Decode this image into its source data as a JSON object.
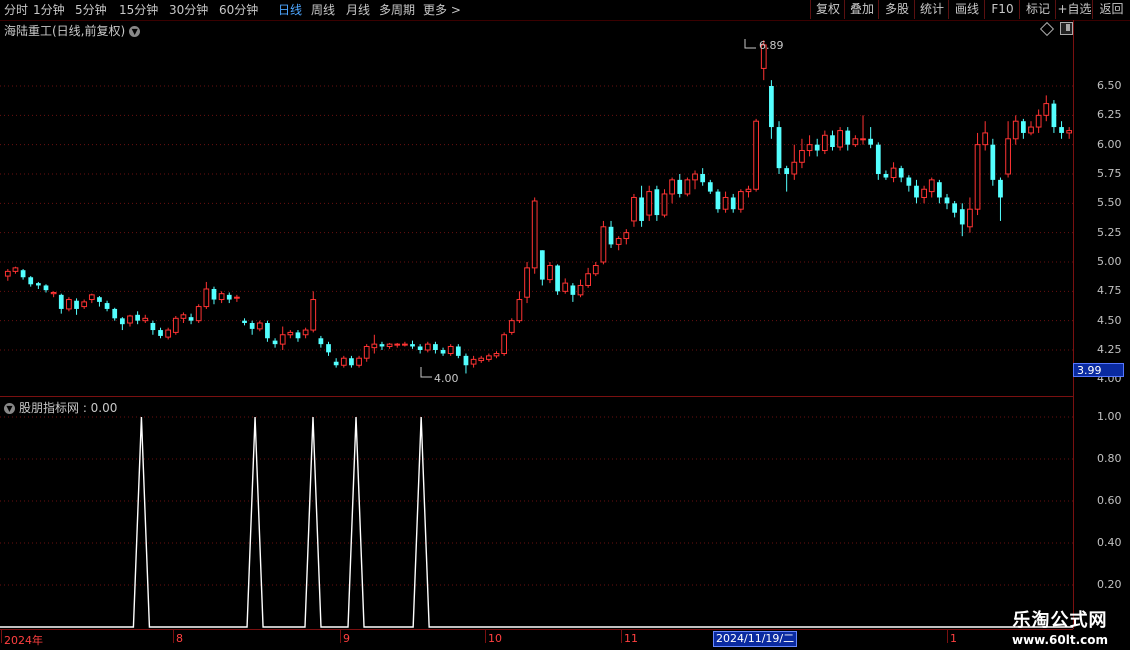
{
  "toolbar": {
    "periods": [
      "分时",
      "1分钟",
      "5分钟",
      "15分钟",
      "30分钟",
      "60分钟",
      "日线",
      "周线",
      "月线",
      "多周期",
      "更多 >"
    ],
    "active_period": "日线",
    "buttons": [
      "复权",
      "叠加",
      "多股",
      "统计",
      "画线",
      "F10",
      "标记",
      "+自选",
      "返回"
    ]
  },
  "main": {
    "title": "海陆重工(日线,前复权)",
    "y_ticks": [
      "6.50",
      "6.25",
      "6.00",
      "5.75",
      "5.50",
      "5.25",
      "5.00",
      "4.75",
      "4.50",
      "4.25",
      "4.00"
    ],
    "current_price": "3.99",
    "high_annotation": "6.89",
    "low_annotation": "4.00"
  },
  "indicator": {
    "title": "股朋指标网 : 0.00",
    "y_ticks": [
      "1.00",
      "0.80",
      "0.60",
      "0.40",
      "0.20"
    ]
  },
  "x_axis": {
    "labels": [
      "2024年",
      "8",
      "9",
      "10",
      "11",
      "2024/11/19/二",
      "1"
    ]
  },
  "brand": {
    "name": "乐淘公式网",
    "url": "www.60lt.com"
  },
  "colors": {
    "up": "#ff3333",
    "down": "#54ffff",
    "grid": "#6a1010",
    "indicator_line": "#ffffff"
  },
  "chart_data": {
    "type": "candlestick",
    "price_range": [
      3.95,
      6.95
    ],
    "candles": [
      [
        4.88,
        4.92,
        4.84,
        4.94
      ],
      [
        4.92,
        4.95,
        4.9,
        4.96
      ],
      [
        4.93,
        4.87,
        4.85,
        4.94
      ],
      [
        4.87,
        4.81,
        4.79,
        4.88
      ],
      [
        4.82,
        4.8,
        4.77,
        4.83
      ],
      [
        4.8,
        4.76,
        4.74,
        4.81
      ],
      [
        4.73,
        4.74,
        4.7,
        4.75
      ],
      [
        4.72,
        4.6,
        4.56,
        4.73
      ],
      [
        4.6,
        4.68,
        4.58,
        4.7
      ],
      [
        4.67,
        4.6,
        4.55,
        4.69
      ],
      [
        4.62,
        4.66,
        4.6,
        4.68
      ],
      [
        4.68,
        4.72,
        4.65,
        4.73
      ],
      [
        4.7,
        4.66,
        4.62,
        4.71
      ],
      [
        4.65,
        4.6,
        4.58,
        4.67
      ],
      [
        4.6,
        4.52,
        4.5,
        4.61
      ],
      [
        4.52,
        4.47,
        4.42,
        4.53
      ],
      [
        4.48,
        4.54,
        4.45,
        4.55
      ],
      [
        4.55,
        4.5,
        4.47,
        4.58
      ],
      [
        4.5,
        4.52,
        4.48,
        4.55
      ],
      [
        4.48,
        4.42,
        4.38,
        4.5
      ],
      [
        4.42,
        4.37,
        4.35,
        4.44
      ],
      [
        4.36,
        4.42,
        4.34,
        4.44
      ],
      [
        4.4,
        4.52,
        4.38,
        4.54
      ],
      [
        4.52,
        4.55,
        4.48,
        4.57
      ],
      [
        4.53,
        4.5,
        4.47,
        4.56
      ],
      [
        4.5,
        4.62,
        4.48,
        4.64
      ],
      [
        4.62,
        4.77,
        4.6,
        4.83
      ],
      [
        4.77,
        4.68,
        4.64,
        4.79
      ],
      [
        4.68,
        4.73,
        4.65,
        4.75
      ],
      [
        4.72,
        4.68,
        4.65,
        4.74
      ],
      [
        4.7,
        4.7,
        4.66,
        4.72
      ],
      [
        4.5,
        4.48,
        4.46,
        4.52
      ],
      [
        4.48,
        4.43,
        4.38,
        4.5
      ],
      [
        4.43,
        4.48,
        4.41,
        4.5
      ],
      [
        4.48,
        4.35,
        4.32,
        4.5
      ],
      [
        4.33,
        4.3,
        4.27,
        4.35
      ],
      [
        4.3,
        4.38,
        4.25,
        4.45
      ],
      [
        4.38,
        4.4,
        4.35,
        4.42
      ],
      [
        4.4,
        4.35,
        4.32,
        4.42
      ],
      [
        4.38,
        4.42,
        4.35,
        4.44
      ],
      [
        4.42,
        4.68,
        4.4,
        4.75
      ],
      [
        4.35,
        4.3,
        4.27,
        4.37
      ],
      [
        4.3,
        4.23,
        4.2,
        4.32
      ],
      [
        4.15,
        4.12,
        4.1,
        4.18
      ],
      [
        4.12,
        4.18,
        4.1,
        4.2
      ],
      [
        4.18,
        4.12,
        4.1,
        4.2
      ],
      [
        4.12,
        4.18,
        4.1,
        4.2
      ],
      [
        4.18,
        4.28,
        4.15,
        4.3
      ],
      [
        4.27,
        4.3,
        4.22,
        4.38
      ],
      [
        4.3,
        4.28,
        4.25,
        4.32
      ],
      [
        4.28,
        4.3,
        4.26,
        4.31
      ],
      [
        4.3,
        4.3,
        4.27,
        4.31
      ],
      [
        4.3,
        4.3,
        4.28,
        4.32
      ],
      [
        4.3,
        4.28,
        4.26,
        4.33
      ],
      [
        4.28,
        4.25,
        4.22,
        4.3
      ],
      [
        4.25,
        4.3,
        4.23,
        4.32
      ],
      [
        4.3,
        4.25,
        4.22,
        4.32
      ],
      [
        4.25,
        4.22,
        4.2,
        4.27
      ],
      [
        4.22,
        4.28,
        4.2,
        4.3
      ],
      [
        4.28,
        4.2,
        4.18,
        4.3
      ],
      [
        4.2,
        4.12,
        4.05,
        4.22
      ],
      [
        4.13,
        4.17,
        4.1,
        4.2
      ],
      [
        4.16,
        4.18,
        4.14,
        4.2
      ],
      [
        4.17,
        4.2,
        4.15,
        4.22
      ],
      [
        4.2,
        4.22,
        4.18,
        4.24
      ],
      [
        4.22,
        4.38,
        4.2,
        4.4
      ],
      [
        4.4,
        4.5,
        4.38,
        4.52
      ],
      [
        4.5,
        4.68,
        4.48,
        4.75
      ],
      [
        4.7,
        4.95,
        4.65,
        5.0
      ],
      [
        4.95,
        5.52,
        4.9,
        5.55
      ],
      [
        5.1,
        4.85,
        4.8,
        5.1
      ],
      [
        4.85,
        4.97,
        4.82,
        5.0
      ],
      [
        4.97,
        4.75,
        4.72,
        4.98
      ],
      [
        4.75,
        4.82,
        4.73,
        4.86
      ],
      [
        4.8,
        4.72,
        4.66,
        4.82
      ],
      [
        4.72,
        4.8,
        4.7,
        4.85
      ],
      [
        4.8,
        4.9,
        4.78,
        4.95
      ],
      [
        4.9,
        4.97,
        4.88,
        5.0
      ],
      [
        5.0,
        5.3,
        4.98,
        5.35
      ],
      [
        5.3,
        5.15,
        5.12,
        5.35
      ],
      [
        5.15,
        5.2,
        5.1,
        5.22
      ],
      [
        5.2,
        5.25,
        5.15,
        5.28
      ],
      [
        5.35,
        5.55,
        5.3,
        5.58
      ],
      [
        5.55,
        5.35,
        5.3,
        5.65
      ],
      [
        5.4,
        5.6,
        5.35,
        5.65
      ],
      [
        5.62,
        5.4,
        5.35,
        5.65
      ],
      [
        5.4,
        5.58,
        5.38,
        5.62
      ],
      [
        5.58,
        5.7,
        5.5,
        5.72
      ],
      [
        5.7,
        5.58,
        5.55,
        5.75
      ],
      [
        5.58,
        5.7,
        5.56,
        5.72
      ],
      [
        5.7,
        5.75,
        5.62,
        5.78
      ],
      [
        5.75,
        5.68,
        5.65,
        5.8
      ],
      [
        5.68,
        5.6,
        5.58,
        5.7
      ],
      [
        5.6,
        5.45,
        5.42,
        5.62
      ],
      [
        5.45,
        5.55,
        5.42,
        5.6
      ],
      [
        5.55,
        5.45,
        5.42,
        5.58
      ],
      [
        5.45,
        5.6,
        5.42,
        5.62
      ],
      [
        5.6,
        5.62,
        5.55,
        5.65
      ],
      [
        5.62,
        6.2,
        5.6,
        6.22
      ],
      [
        6.65,
        6.85,
        6.55,
        6.89
      ],
      [
        6.5,
        6.15,
        6.05,
        6.55
      ],
      [
        6.15,
        5.8,
        5.75,
        6.2
      ],
      [
        5.8,
        5.75,
        5.6,
        5.82
      ],
      [
        5.75,
        5.85,
        5.7,
        6.0
      ],
      [
        5.85,
        5.95,
        5.8,
        6.05
      ],
      [
        5.95,
        6.0,
        5.9,
        6.08
      ],
      [
        6.0,
        5.95,
        5.9,
        6.05
      ],
      [
        5.95,
        6.08,
        5.92,
        6.12
      ],
      [
        6.08,
        5.98,
        5.95,
        6.12
      ],
      [
        5.98,
        6.12,
        5.95,
        6.15
      ],
      [
        6.12,
        6.0,
        5.95,
        6.15
      ],
      [
        6.0,
        6.05,
        5.98,
        6.08
      ],
      [
        6.05,
        6.05,
        6.0,
        6.25
      ],
      [
        6.05,
        6.0,
        5.97,
        6.15
      ],
      [
        6.0,
        5.75,
        5.7,
        6.02
      ],
      [
        5.75,
        5.72,
        5.7,
        5.78
      ],
      [
        5.72,
        5.8,
        5.68,
        5.85
      ],
      [
        5.8,
        5.72,
        5.68,
        5.82
      ],
      [
        5.72,
        5.65,
        5.6,
        5.74
      ],
      [
        5.65,
        5.55,
        5.5,
        5.7
      ],
      [
        5.55,
        5.62,
        5.5,
        5.65
      ],
      [
        5.6,
        5.7,
        5.55,
        5.72
      ],
      [
        5.68,
        5.55,
        5.5,
        5.7
      ],
      [
        5.55,
        5.5,
        5.45,
        5.58
      ],
      [
        5.5,
        5.42,
        5.38,
        5.52
      ],
      [
        5.45,
        5.32,
        5.22,
        5.5
      ],
      [
        5.3,
        5.45,
        5.25,
        5.55
      ],
      [
        5.45,
        6.0,
        5.4,
        6.1
      ],
      [
        6.0,
        6.1,
        5.95,
        6.2
      ],
      [
        6.0,
        5.7,
        5.65,
        6.05
      ],
      [
        5.7,
        5.55,
        5.35,
        5.72
      ],
      [
        5.75,
        6.05,
        5.72,
        6.2
      ],
      [
        6.05,
        6.2,
        6.0,
        6.25
      ],
      [
        6.2,
        6.1,
        6.05,
        6.22
      ],
      [
        6.1,
        6.15,
        6.08,
        6.2
      ],
      [
        6.15,
        6.25,
        6.1,
        6.3
      ],
      [
        6.25,
        6.35,
        6.2,
        6.42
      ],
      [
        6.35,
        6.15,
        6.1,
        6.38
      ],
      [
        6.15,
        6.1,
        6.05,
        6.2
      ],
      [
        6.1,
        6.12,
        6.05,
        6.15
      ]
    ]
  },
  "indicator_data": {
    "type": "line",
    "y_range": [
      0,
      1
    ],
    "signals_at_fraction": [
      0.1318,
      0.2377,
      0.2917,
      0.3318,
      0.3925
    ],
    "signal_value": 1.0,
    "base_value": 0.0
  }
}
